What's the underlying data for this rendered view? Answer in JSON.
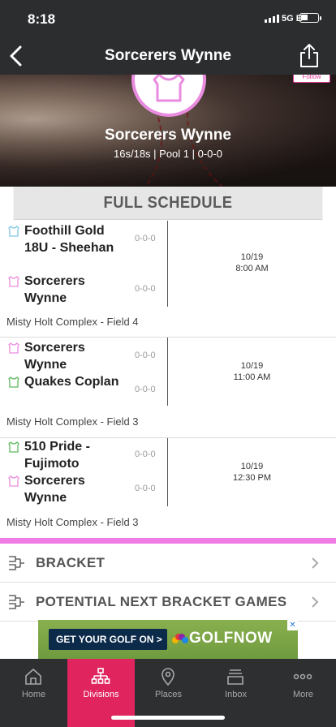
{
  "status_bar": {
    "time": "8:18",
    "network": "5G E"
  },
  "nav": {
    "title": "Sorcerers Wynne"
  },
  "hero": {
    "team_name": "Sorcerers Wynne",
    "meta": "16s/18s | Pool 1 | 0-0-0",
    "follow_label": "Follow"
  },
  "schedule": {
    "header": "FULL SCHEDULE",
    "games": [
      {
        "team1": {
          "name": "Foothill Gold 18U - Sheehan",
          "record": "0-0-0",
          "jersey_color": "#7ec8e3"
        },
        "team2": {
          "name": "Sorcerers Wynne",
          "record": "0-0-0",
          "jersey_color": "#e98bdf"
        },
        "date": "10/19",
        "time": "8:00 AM",
        "venue": "Misty Holt Complex - Field 4"
      },
      {
        "team1": {
          "name": "Sorcerers Wynne",
          "record": "0-0-0",
          "jersey_color": "#e98bdf"
        },
        "team2": {
          "name": "Quakes Coplan",
          "record": "0-0-0",
          "jersey_color": "#5cb85c"
        },
        "date": "10/19",
        "time": "11:00 AM",
        "venue": "Misty Holt Complex - Field 3"
      },
      {
        "team1": {
          "name": "510 Pride - Fujimoto",
          "record": "0-0-0",
          "jersey_color": "#5cb85c"
        },
        "team2": {
          "name": "Sorcerers Wynne",
          "record": "0-0-0",
          "jersey_color": "#e98bdf"
        },
        "date": "10/19",
        "time": "12:30 PM",
        "venue": "Misty Holt Complex - Field 3"
      }
    ]
  },
  "menu": {
    "bracket": "BRACKET",
    "potential": "POTENTIAL NEXT BRACKET GAMES"
  },
  "ad": {
    "button": "GET YOUR GOLF ON >",
    "brand": "GOLFNOW"
  },
  "tabs": [
    {
      "label": "Home",
      "icon": "home-icon"
    },
    {
      "label": "Divisions",
      "icon": "divisions-icon",
      "active": true
    },
    {
      "label": "Places",
      "icon": "places-icon"
    },
    {
      "label": "Inbox",
      "icon": "inbox-icon"
    },
    {
      "label": "More",
      "icon": "more-icon"
    }
  ],
  "colors": {
    "accent": "#e0245e",
    "pink": "#f07de6",
    "nav_bg": "#2c2d2f"
  }
}
